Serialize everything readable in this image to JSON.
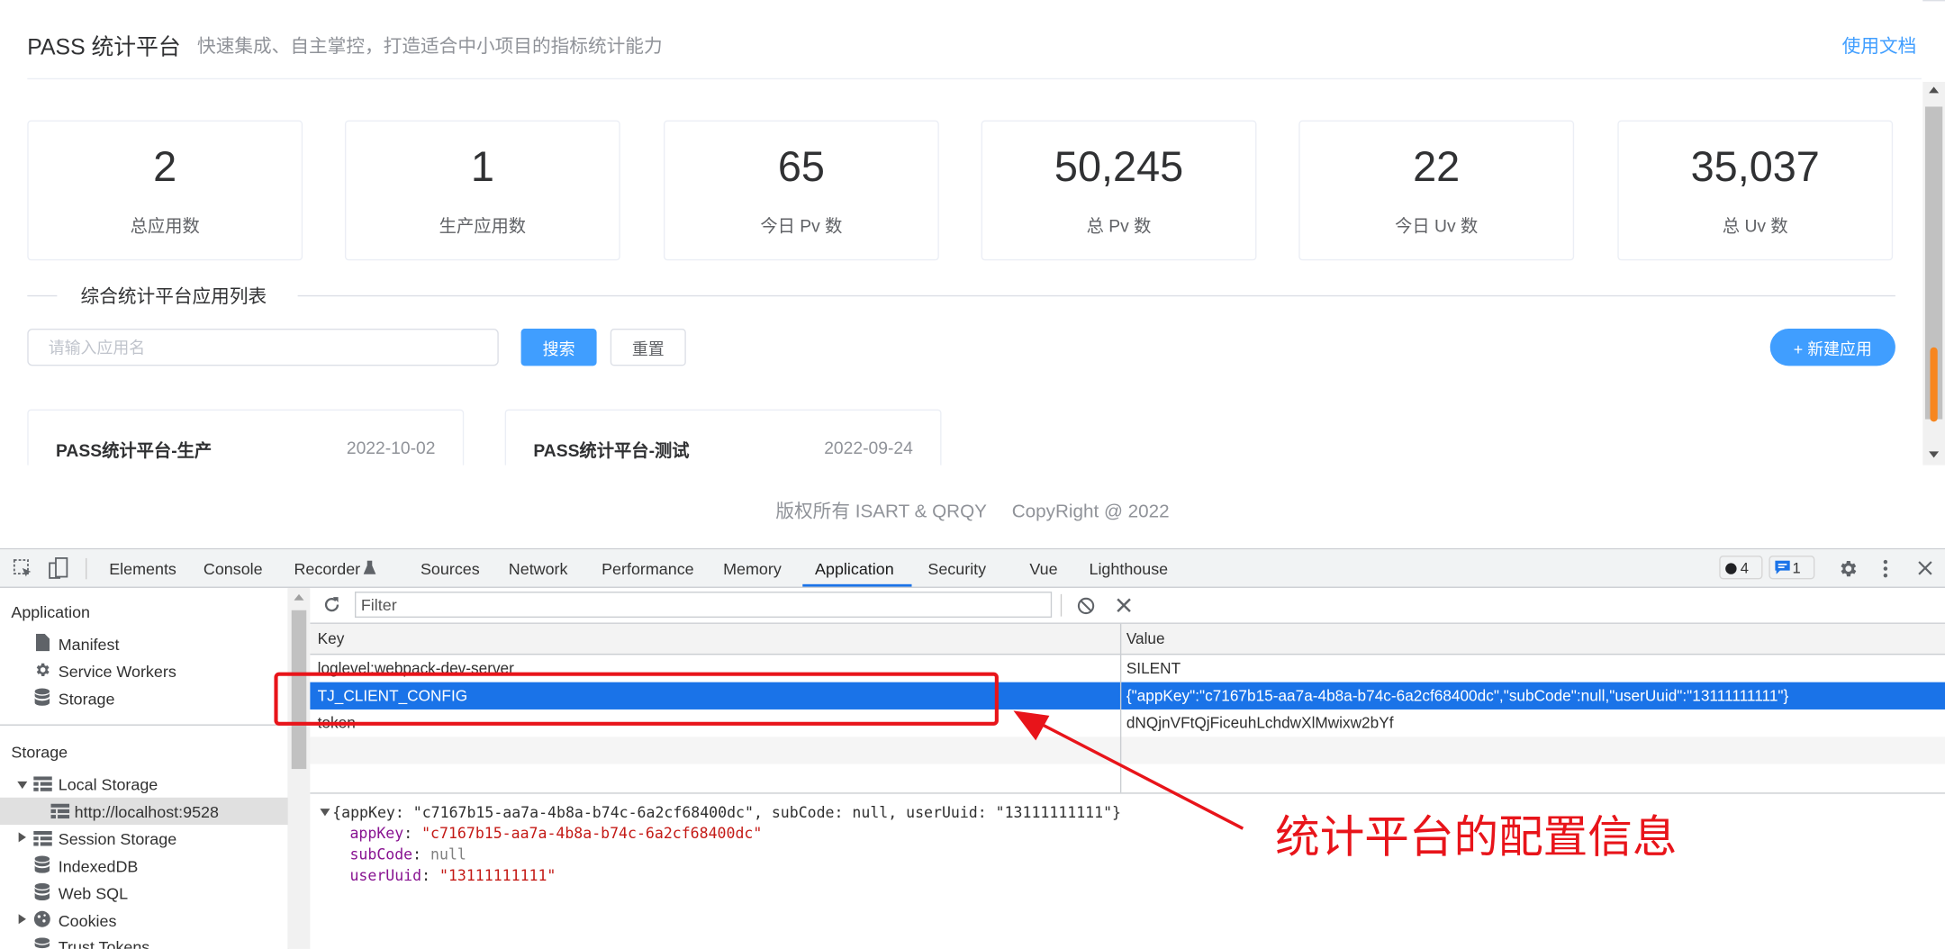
{
  "header": {
    "title": "PASS 统计平台",
    "subtitle": "快速集成、自主掌控，打造适合中小项目的指标统计能力",
    "docs_link": "使用文档"
  },
  "stats": [
    {
      "value": "2",
      "label": "总应用数"
    },
    {
      "value": "1",
      "label": "生产应用数"
    },
    {
      "value": "65",
      "label": "今日 Pv 数"
    },
    {
      "value": "50,245",
      "label": "总 Pv 数"
    },
    {
      "value": "22",
      "label": "今日 Uv 数"
    },
    {
      "value": "35,037",
      "label": "总 Uv 数"
    }
  ],
  "section": {
    "title": "综合统计平台应用列表",
    "search_placeholder": "请输入应用名",
    "search_button": "搜索",
    "reset_button": "重置",
    "new_button": "+ 新建应用"
  },
  "apps": [
    {
      "name": "PASS统计平台-生产",
      "date": "2022-10-02"
    },
    {
      "name": "PASS统计平台-测试",
      "date": "2022-09-24"
    }
  ],
  "footer": {
    "rights": "版权所有 ISART & QRQY",
    "copyright": "CopyRight @ 2022"
  },
  "devtools": {
    "tabs": [
      "Elements",
      "Console",
      "Recorder",
      "Sources",
      "Network",
      "Performance",
      "Memory",
      "Application",
      "Security",
      "Vue",
      "Lighthouse"
    ],
    "active_tab": "Application",
    "error_count": "4",
    "message_count": "1",
    "sidebar": {
      "app_header": "Application",
      "app_items": [
        "Manifest",
        "Service Workers",
        "Storage"
      ],
      "storage_header": "Storage",
      "local_storage": "Local Storage",
      "local_origin": "http://localhost:9528",
      "storage_items": [
        "Session Storage",
        "IndexedDB",
        "Web SQL",
        "Cookies",
        "Trust Tokens"
      ]
    },
    "filter_placeholder": "Filter",
    "grid": {
      "key_header": "Key",
      "value_header": "Value",
      "rows": [
        {
          "key": "loglevel:webpack-dev-server",
          "value": "SILENT"
        },
        {
          "key": "TJ_CLIENT_CONFIG",
          "value": "{\"appKey\":\"c7167b15-aa7a-4b8a-b74c-6a2cf68400dc\",\"subCode\":null,\"userUuid\":\"13111111111\"}"
        },
        {
          "key": "token",
          "value": "dNQjnVFtQjFiceuhLchdwXlMwixw2bYf"
        }
      ]
    },
    "preview": {
      "summary": "{appKey: \"c7167b15-aa7a-4b8a-b74c-6a2cf68400dc\", subCode: null, userUuid: \"13111111111\"}",
      "fields": [
        {
          "k": "appKey",
          "v": "\"c7167b15-aa7a-4b8a-b74c-6a2cf68400dc\"",
          "color": "#c41a16"
        },
        {
          "k": "subCode",
          "v": "null",
          "color": "#808080"
        },
        {
          "k": "userUuid",
          "v": "\"13111111111\"",
          "color": "#c41a16"
        }
      ]
    }
  },
  "annotation": {
    "text": "统计平台的配置信息",
    "color": "#e8141a"
  }
}
